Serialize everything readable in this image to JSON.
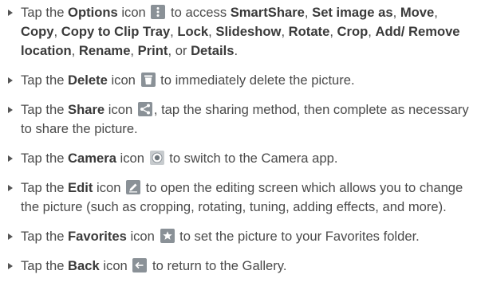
{
  "items": [
    {
      "parts": [
        {
          "t": "Tap the "
        },
        {
          "t": "Options",
          "b": true
        },
        {
          "t": " icon "
        },
        {
          "icon": "options-icon"
        },
        {
          "t": " to access "
        },
        {
          "t": "SmartShare",
          "b": true
        },
        {
          "t": ", "
        },
        {
          "t": "Set image as",
          "b": true
        },
        {
          "t": ", "
        },
        {
          "t": "Move",
          "b": true
        },
        {
          "t": ", "
        },
        {
          "t": "Copy",
          "b": true
        },
        {
          "t": ", "
        },
        {
          "t": "Copy to Clip Tray",
          "b": true
        },
        {
          "t": ", "
        },
        {
          "t": "Lock",
          "b": true
        },
        {
          "t": ", "
        },
        {
          "t": "Slideshow",
          "b": true
        },
        {
          "t": ", "
        },
        {
          "t": "Rotate",
          "b": true
        },
        {
          "t": ", "
        },
        {
          "t": "Crop",
          "b": true
        },
        {
          "t": ", "
        },
        {
          "t": "Add/ Remove location",
          "b": true
        },
        {
          "t": ", "
        },
        {
          "t": "Rename",
          "b": true
        },
        {
          "t": ", "
        },
        {
          "t": "Print",
          "b": true
        },
        {
          "t": ", or "
        },
        {
          "t": "Details",
          "b": true
        },
        {
          "t": "."
        }
      ]
    },
    {
      "parts": [
        {
          "t": "Tap the "
        },
        {
          "t": "Delete",
          "b": true
        },
        {
          "t": " icon "
        },
        {
          "icon": "delete-icon"
        },
        {
          "t": " to immediately delete the picture."
        }
      ]
    },
    {
      "parts": [
        {
          "t": "Tap the "
        },
        {
          "t": "Share",
          "b": true
        },
        {
          "t": " icon "
        },
        {
          "icon": "share-icon"
        },
        {
          "t": ", tap the sharing method, then complete as necessary to share the picture."
        }
      ]
    },
    {
      "parts": [
        {
          "t": "Tap the "
        },
        {
          "t": "Camera",
          "b": true
        },
        {
          "t": " icon "
        },
        {
          "icon": "camera-icon"
        },
        {
          "t": " to switch to the Camera app."
        }
      ]
    },
    {
      "parts": [
        {
          "t": "Tap the "
        },
        {
          "t": "Edit",
          "b": true
        },
        {
          "t": " icon "
        },
        {
          "icon": "edit-icon"
        },
        {
          "t": " to open the editing screen which allows you to change the picture (such as cropping, rotating, tuning, adding effects, and more)."
        }
      ]
    },
    {
      "parts": [
        {
          "t": "Tap the "
        },
        {
          "t": "Favorites",
          "b": true
        },
        {
          "t": " icon "
        },
        {
          "icon": "favorites-icon"
        },
        {
          "t": " to set the picture to your Favorites folder."
        }
      ]
    },
    {
      "parts": [
        {
          "t": "Tap the "
        },
        {
          "t": "Back",
          "b": true
        },
        {
          "t": " icon "
        },
        {
          "icon": "back-icon"
        },
        {
          "t": " to return to the Gallery."
        }
      ]
    }
  ],
  "colors": {
    "text": "#4a4a4a",
    "icon_bg_dark": "#8a9197",
    "icon_bg_light": "#c7cbce",
    "icon_fg": "#ffffff"
  }
}
